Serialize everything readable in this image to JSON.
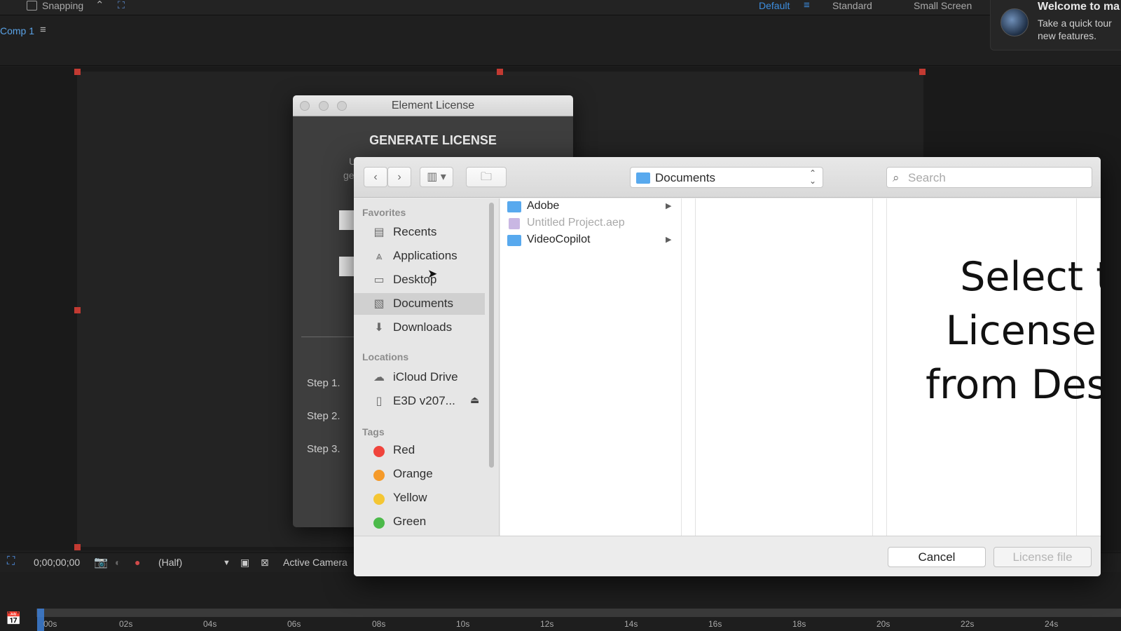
{
  "topbar": {
    "snapping_label": "Snapping",
    "workspaces": [
      "Default",
      "Standard",
      "Small Screen"
    ],
    "active_workspace_color": "#3d8ee0"
  },
  "welcome": {
    "title": "Welcome to ma",
    "body_line1": "Take a quick tour",
    "body_line2": "new features."
  },
  "comp_panel": {
    "tab_label": "Comp 1",
    "menu_icon": "hamburger-icon"
  },
  "viewer_bar": {
    "timecode": "0;00;00;00",
    "resolution": "(Half)",
    "camera": "Active Camera"
  },
  "timeline": {
    "ticks": [
      "00s",
      "02s",
      "04s",
      "06s",
      "08s",
      "10s",
      "12s",
      "14s",
      "16s",
      "18s",
      "20s",
      "22s",
      "24s"
    ]
  },
  "license_window": {
    "title": "Element License",
    "heading": "GENERATE LICENSE",
    "sub_partial_line1": "U",
    "sub_partial_line2": "ge",
    "steps": [
      "Step 1.",
      "Step 2.",
      "Step 3."
    ]
  },
  "dialog": {
    "location": "Documents",
    "search_placeholder": "Search",
    "sidebar": {
      "favorites_header": "Favorites",
      "favorites": [
        {
          "label": "Recents",
          "icon": "recents-icon"
        },
        {
          "label": "Applications",
          "icon": "applications-icon"
        },
        {
          "label": "Desktop",
          "icon": "desktop-icon"
        },
        {
          "label": "Documents",
          "icon": "documents-icon",
          "selected": true
        },
        {
          "label": "Downloads",
          "icon": "downloads-icon"
        }
      ],
      "locations_header": "Locations",
      "locations": [
        {
          "label": "iCloud Drive",
          "icon": "cloud-icon"
        },
        {
          "label": "E3D v207...",
          "icon": "disk-icon"
        }
      ],
      "tags_header": "Tags",
      "tags": [
        {
          "label": "Red",
          "color": "#f0443c"
        },
        {
          "label": "Orange",
          "color": "#f59a2a"
        },
        {
          "label": "Yellow",
          "color": "#f4c633"
        },
        {
          "label": "Green",
          "color": "#4cba4a"
        }
      ]
    },
    "files": [
      {
        "name": "Adobe",
        "type": "folder",
        "dimmed": false
      },
      {
        "name": "Untitled Project.aep",
        "type": "aep",
        "dimmed": true
      },
      {
        "name": "VideoCopilot",
        "type": "folder",
        "dimmed": false
      }
    ],
    "overlay_line1": "Select the",
    "overlay_line2": "License File",
    "overlay_line3": "from Desktop",
    "cancel_label": "Cancel",
    "confirm_label": "License file"
  }
}
